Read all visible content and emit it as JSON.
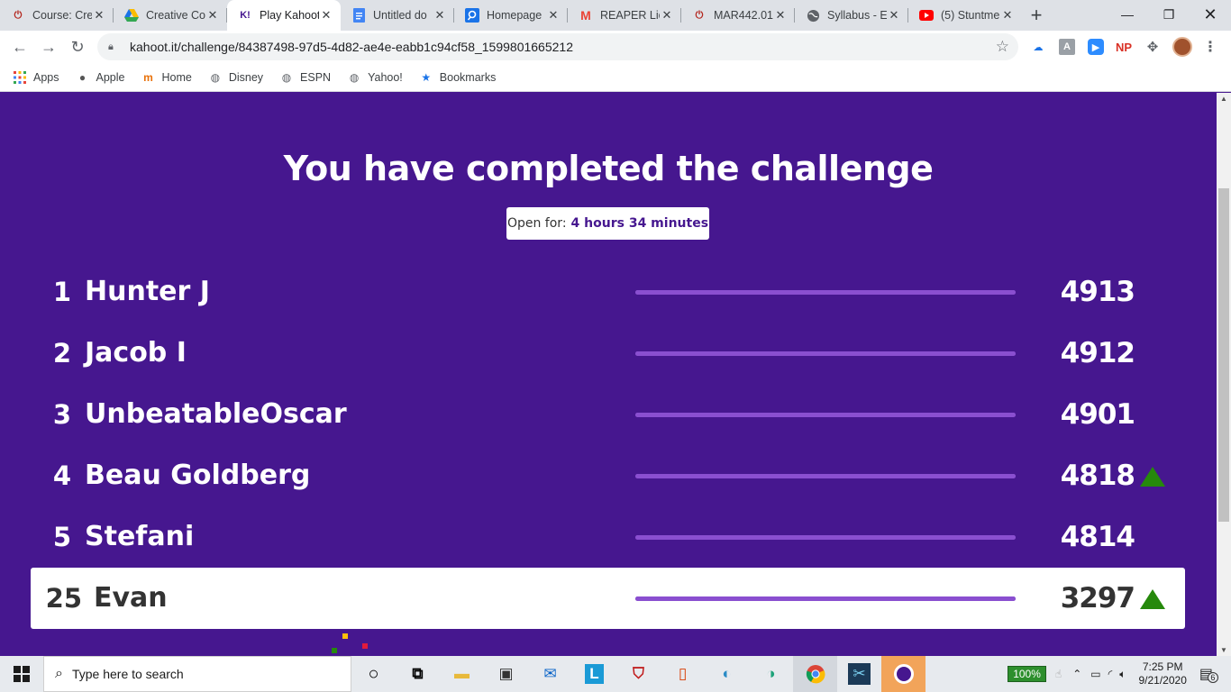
{
  "browser": {
    "tabs": [
      {
        "title": "Course: Cre",
        "icon": "power-icon",
        "color": "#b3261e"
      },
      {
        "title": "Creative Co",
        "icon": "drive-icon",
        "color": "#1a73e8"
      },
      {
        "title": "Play Kahoot",
        "icon": "kahoot-icon",
        "color": "#46178f",
        "active": true
      },
      {
        "title": "Untitled do",
        "icon": "docs-icon",
        "color": "#4285f4"
      },
      {
        "title": "Homepage",
        "icon": "search-doc-icon",
        "color": "#1a73e8"
      },
      {
        "title": "REAPER Lice",
        "icon": "gmail-icon",
        "color": "#ea4335"
      },
      {
        "title": "MAR442.01",
        "icon": "power-icon",
        "color": "#b3261e"
      },
      {
        "title": "Syllabus - E",
        "icon": "globe-icon",
        "color": "#5f6368"
      },
      {
        "title": "(5) Stuntme",
        "icon": "youtube-icon",
        "color": "#ff0000"
      }
    ],
    "url": "kahoot.it/challenge/84387498-97d5-4d82-ae4e-eabb1c94cf58_1599801665212",
    "bookmarks": [
      {
        "label": "Apps",
        "icon": "apps-grid-icon"
      },
      {
        "label": "Apple",
        "icon": "apple-icon"
      },
      {
        "label": "Home",
        "icon": "home-icon"
      },
      {
        "label": "Disney",
        "icon": "globe-icon"
      },
      {
        "label": "ESPN",
        "icon": "globe-icon"
      },
      {
        "label": "Yahoo!",
        "icon": "globe-icon"
      },
      {
        "label": "Bookmarks",
        "icon": "star-icon"
      }
    ],
    "extensions": [
      "cloud-icon",
      "grammar-icon",
      "zoom-icon",
      "np-icon",
      "puzzle-icon",
      "profile-avatar"
    ]
  },
  "page": {
    "headline": "You have completed the challenge",
    "open_for_label": "Open for:",
    "open_for_value": "4 hours 34 minutes",
    "accent_color": "#46178f",
    "leaderboard": [
      {
        "rank": "1",
        "name": "Hunter J",
        "score": "4913",
        "arrow": false,
        "progress": 1.0
      },
      {
        "rank": "2",
        "name": "Jacob I",
        "score": "4912",
        "arrow": false,
        "progress": 1.0
      },
      {
        "rank": "3",
        "name": "UnbeatableOscar",
        "score": "4901",
        "arrow": false,
        "progress": 1.0
      },
      {
        "rank": "4",
        "name": "Beau Goldberg",
        "score": "4818",
        "arrow": true,
        "progress": 1.0
      },
      {
        "rank": "5",
        "name": "Stefani",
        "score": "4814",
        "arrow": false,
        "progress": 1.0
      }
    ],
    "current_player": {
      "rank": "25",
      "name": "Evan",
      "score": "3297",
      "arrow": true,
      "progress": 1.0
    }
  },
  "taskbar": {
    "search_placeholder": "Type here to search",
    "apps": [
      "cortana-icon",
      "task-view-icon",
      "file-explorer-icon",
      "store-icon",
      "mail-icon",
      "l-app-icon",
      "mcafee-icon",
      "office-icon",
      "edge-legacy-icon",
      "edge-icon",
      "chrome-icon",
      "snip-icon",
      "kahoot-app-icon"
    ],
    "battery": "100%",
    "time": "7:25 PM",
    "date": "9/21/2020",
    "notifications": "6"
  }
}
